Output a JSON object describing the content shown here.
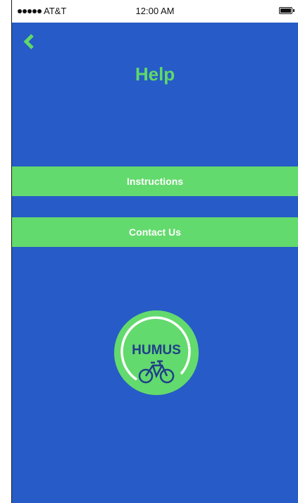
{
  "status_bar": {
    "carrier": "AT&T",
    "time": "12:00 AM",
    "battery_icon": "battery-icon",
    "signal_icon": "signal-dots-icon"
  },
  "header": {
    "back_icon": "chevron-left-icon",
    "title": "Help"
  },
  "menu": {
    "instructions_label": "Instructions",
    "contact_label": "Contact Us"
  },
  "logo": {
    "text": "HUMUS",
    "icon": "bicycle-icon"
  },
  "colors": {
    "background": "#275bc7",
    "accent_green": "#63da6d",
    "title_green": "#5fd969",
    "logo_text": "#1f3f8a"
  }
}
